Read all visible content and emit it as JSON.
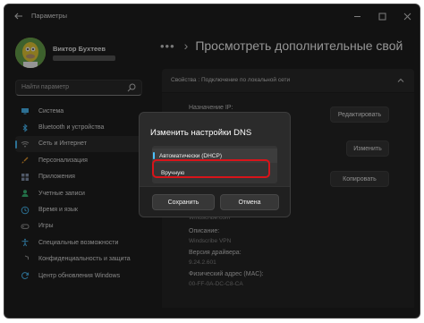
{
  "window": {
    "title": "Параметры",
    "controls": [
      "minimize-icon",
      "maximize-icon",
      "close-icon"
    ]
  },
  "profile": {
    "name": "Виктор Бухтеев"
  },
  "search": {
    "placeholder": "Найти параметр"
  },
  "sidebar": {
    "active_index": 2,
    "items": [
      {
        "label": "Система",
        "icon": "system-icon",
        "color": "#4cc2ff"
      },
      {
        "label": "Bluetooth и устройства",
        "icon": "bluetooth-icon",
        "color": "#4cc2ff"
      },
      {
        "label": "Сеть и Интернет",
        "icon": "network-icon",
        "color": "#a0a0a0"
      },
      {
        "label": "Персонализация",
        "icon": "brush-icon",
        "color": "#f0a030"
      },
      {
        "label": "Приложения",
        "icon": "apps-icon",
        "color": "#8a9ab5"
      },
      {
        "label": "Учетные записи",
        "icon": "account-icon",
        "color": "#3cbf7a"
      },
      {
        "label": "Время и язык",
        "icon": "time-language-icon",
        "color": "#4cc2ff"
      },
      {
        "label": "Игры",
        "icon": "gamepad-icon",
        "color": "#a0a0a0"
      },
      {
        "label": "Специальные возможности",
        "icon": "accessibility-icon",
        "color": "#4cc2ff"
      },
      {
        "label": "Конфиденциальность и защита",
        "icon": "shield-icon",
        "color": "#a0a0a0"
      },
      {
        "label": "Центр обновления Windows",
        "icon": "update-icon",
        "color": "#4cc2ff"
      }
    ]
  },
  "breadcrumb": {
    "dots": "•••",
    "title": "Просмотреть дополнительные свой"
  },
  "properties": {
    "header": "Свойства : Подключение по локальной сети",
    "ip_label": "Назначение IP:",
    "edit_button": "Редактировать",
    "change_button": "Изменить",
    "copy_button": "Копировать",
    "partial_value": "Windscribe.com",
    "description_label": "Описание:",
    "description_value": "Windscribe VPN",
    "driver_label": "Версия драйвера:",
    "driver_value": "9.24.2.601",
    "mac_label": "Физический адрес (MAC):",
    "mac_value": "00-FF-0A-DC-C8-CA"
  },
  "dialog": {
    "title": "Изменить настройки DNS",
    "options": [
      "Автоматически (DHCP)",
      "Вручную"
    ],
    "save_button": "Сохранить",
    "cancel_button": "Отмена",
    "highlight_color": "#d8141a"
  }
}
